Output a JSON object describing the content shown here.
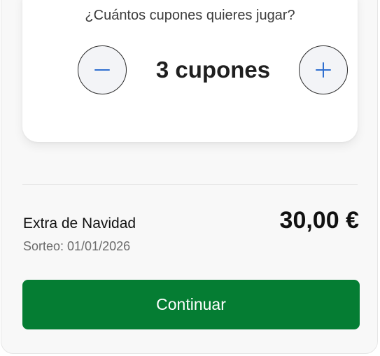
{
  "selector": {
    "question": "¿Cuántos cupones quieres jugar?",
    "count_label": "3 cupones",
    "minus_icon": "minus-icon",
    "plus_icon": "plus-icon"
  },
  "summary": {
    "game_name": "Extra de Navidad",
    "draw_date": "Sorteo: 01/01/2026",
    "price": "30,00 €"
  },
  "actions": {
    "continue_label": "Continuar"
  },
  "colors": {
    "primary_green": "#057d33",
    "icon_blue": "#2f6fd0"
  }
}
